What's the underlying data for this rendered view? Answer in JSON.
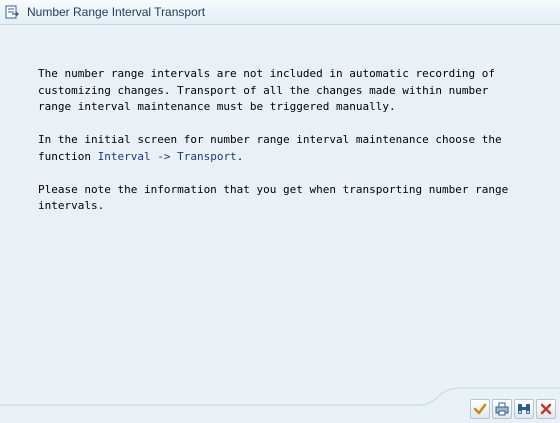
{
  "window": {
    "title": "Number Range Interval Transport"
  },
  "content": {
    "paragraph1": "The number range intervals are not included in automatic recording of\ncustomizing changes.  Transport of all the changes made within number\nrange interval maintenance must be triggered manually.",
    "paragraph2_prefix": "In the initial screen for number range interval maintenance choose the\nfunction ",
    "paragraph2_link": "Interval -> Transport",
    "paragraph2_suffix": ".",
    "paragraph3": "Please note the information that you get when transporting number range\nintervals."
  },
  "toolbar": {
    "buttons": [
      {
        "icon": "checkmark-icon",
        "color": "#c88a12"
      },
      {
        "icon": "print-icon",
        "color": "#3a5f86"
      },
      {
        "icon": "find-icon",
        "color": "#2e5b8a"
      },
      {
        "icon": "cancel-icon",
        "color": "#c0392b"
      }
    ]
  }
}
